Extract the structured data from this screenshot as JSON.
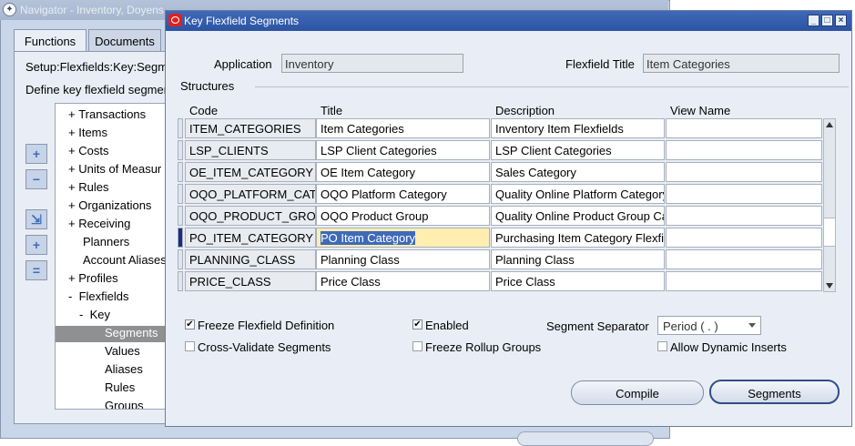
{
  "navigator": {
    "title": "Navigator - Inventory, Doyens",
    "tabs": [
      "Functions",
      "Documents"
    ],
    "setup_path": "Setup:Flexfields:Key:Segm",
    "define_text": "Define key flexfield segmen",
    "tree": [
      {
        "prefix": "+",
        "label": "Transactions"
      },
      {
        "prefix": "+",
        "label": "Items"
      },
      {
        "prefix": "+",
        "label": "Costs"
      },
      {
        "prefix": "+",
        "label": "Units of Measur"
      },
      {
        "prefix": "+",
        "label": "Rules"
      },
      {
        "prefix": "+",
        "label": "Organizations"
      },
      {
        "prefix": "+",
        "label": "Receiving"
      },
      {
        "prefix": "",
        "label": "Planners"
      },
      {
        "prefix": "",
        "label": "Account Aliases"
      },
      {
        "prefix": "+",
        "label": "Profiles"
      },
      {
        "prefix": "-",
        "label": "Flexfields"
      },
      {
        "prefix": "-",
        "label": "Key"
      },
      {
        "prefix": "",
        "label": "Segments",
        "selected": true
      },
      {
        "prefix": "",
        "label": "Values"
      },
      {
        "prefix": "",
        "label": "Aliases"
      },
      {
        "prefix": "",
        "label": "Rules"
      },
      {
        "prefix": "",
        "label": "Groups"
      }
    ]
  },
  "dialog": {
    "title": "Key Flexfield Segments",
    "application_label": "Application",
    "application_value": "Inventory",
    "flexfield_title_label": "Flexfield Title",
    "flexfield_title_value": "Item Categories",
    "structures_label": "Structures",
    "columns": [
      "Code",
      "Title",
      "Description",
      "View Name"
    ],
    "rows": [
      {
        "code": "ITEM_CATEGORIES",
        "title": "Item Categories",
        "description": "Inventory Item Flexfields",
        "view": ""
      },
      {
        "code": "LSP_CLIENTS",
        "title": "LSP Client Categories",
        "description": "LSP Client Categories",
        "view": ""
      },
      {
        "code": "OE_ITEM_CATEGORY",
        "title": "OE Item Category",
        "description": "Sales Category",
        "view": ""
      },
      {
        "code": "OQO_PLATFORM_CAT",
        "title": "OQO Platform Category",
        "description": "Quality Online Platform Category",
        "view": ""
      },
      {
        "code": "OQO_PRODUCT_GROU",
        "title": "OQO Product Group",
        "description": "Quality Online Product Group Ca",
        "view": ""
      },
      {
        "code": "PO_ITEM_CATEGORY",
        "title": "PO Item Category",
        "description": "Purchasing Item Category Flexfie",
        "view": "",
        "selected": true
      },
      {
        "code": "PLANNING_CLASS",
        "title": "Planning Class",
        "description": "Planning Class",
        "view": ""
      },
      {
        "code": "PRICE_CLASS",
        "title": "Price Class",
        "description": "Price Class",
        "view": ""
      }
    ],
    "freeze_definition": {
      "label": "Freeze Flexfield Definition",
      "checked": true
    },
    "enabled": {
      "label": "Enabled",
      "checked": true
    },
    "cross_validate": {
      "label": "Cross-Validate Segments",
      "checked": false
    },
    "freeze_rollup": {
      "label": "Freeze Rollup Groups",
      "checked": false
    },
    "allow_dynamic": {
      "label": "Allow Dynamic Inserts",
      "checked": false
    },
    "separator_label": "Segment Separator",
    "separator_value": "Period ( . )",
    "compile_label": "Compile",
    "segments_label": "Segments"
  },
  "colors": {
    "dialog_title_bar": "#2c54a3",
    "selected_cell": "#ffeeb0",
    "selected_text": "#3f69b9",
    "tree_selected": "#8f9092"
  }
}
